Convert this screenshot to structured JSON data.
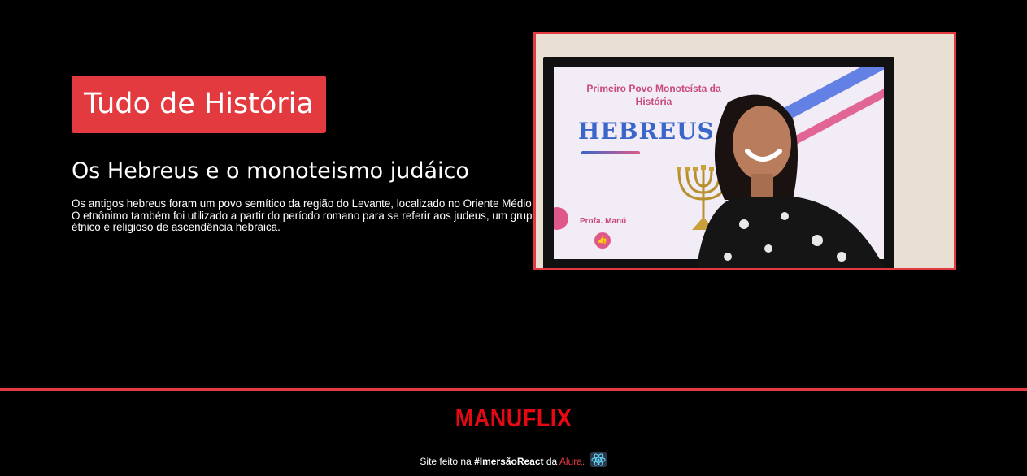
{
  "banner": {
    "category": "Tudo de História",
    "video_title": "Os Hebreus e o monoteismo judáico",
    "video_description": "Os antigos hebreus foram um povo semítico da região do Levante, localizado no Oriente Médio. O etnônimo também foi utilizado a partir do período romano para se referir aos judeus, um grupo étnico e religioso de ascendência hebraica.",
    "thumbnail": {
      "slide_title": "Primeiro Povo Monoteísta da História",
      "slide_heading": "HEBREUS",
      "slide_author": "Profa. Manú",
      "icon": "menorah-icon"
    }
  },
  "footer": {
    "logo": "MANUFLIX",
    "credit_prefix": "Site feito na",
    "credit_event": "#ImersãoReact",
    "credit_middle": "da",
    "credit_company": "Alura.",
    "react_icon": "react-atom-icon"
  },
  "colors": {
    "accent": "#e33a3f",
    "logo_red": "#e50914",
    "background": "#000000"
  }
}
